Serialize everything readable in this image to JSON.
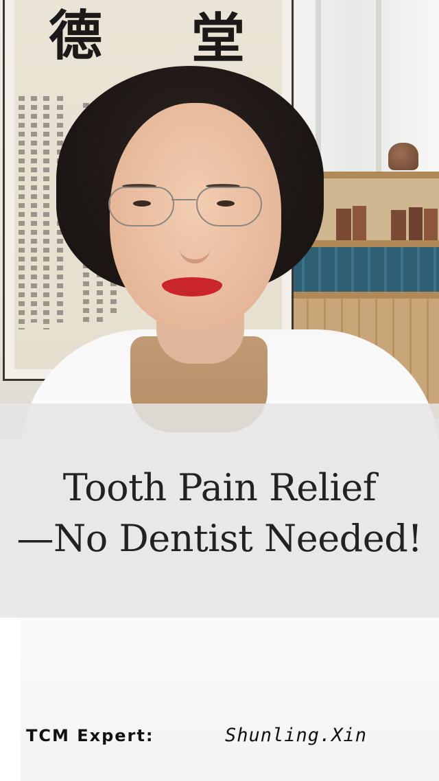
{
  "background": {
    "calligraphy_chars": [
      "德",
      "堂"
    ],
    "accent_colors": {
      "coat": "#ffffff",
      "sweater": "#b58d66",
      "lips": "#c8262a",
      "hair": "#1b1513"
    }
  },
  "title": {
    "line1": "Tooth Pain Relief",
    "line2": "—No Dentist Needed!"
  },
  "footer": {
    "label": "TCM Expert:",
    "name": "Shunling.Xin"
  }
}
